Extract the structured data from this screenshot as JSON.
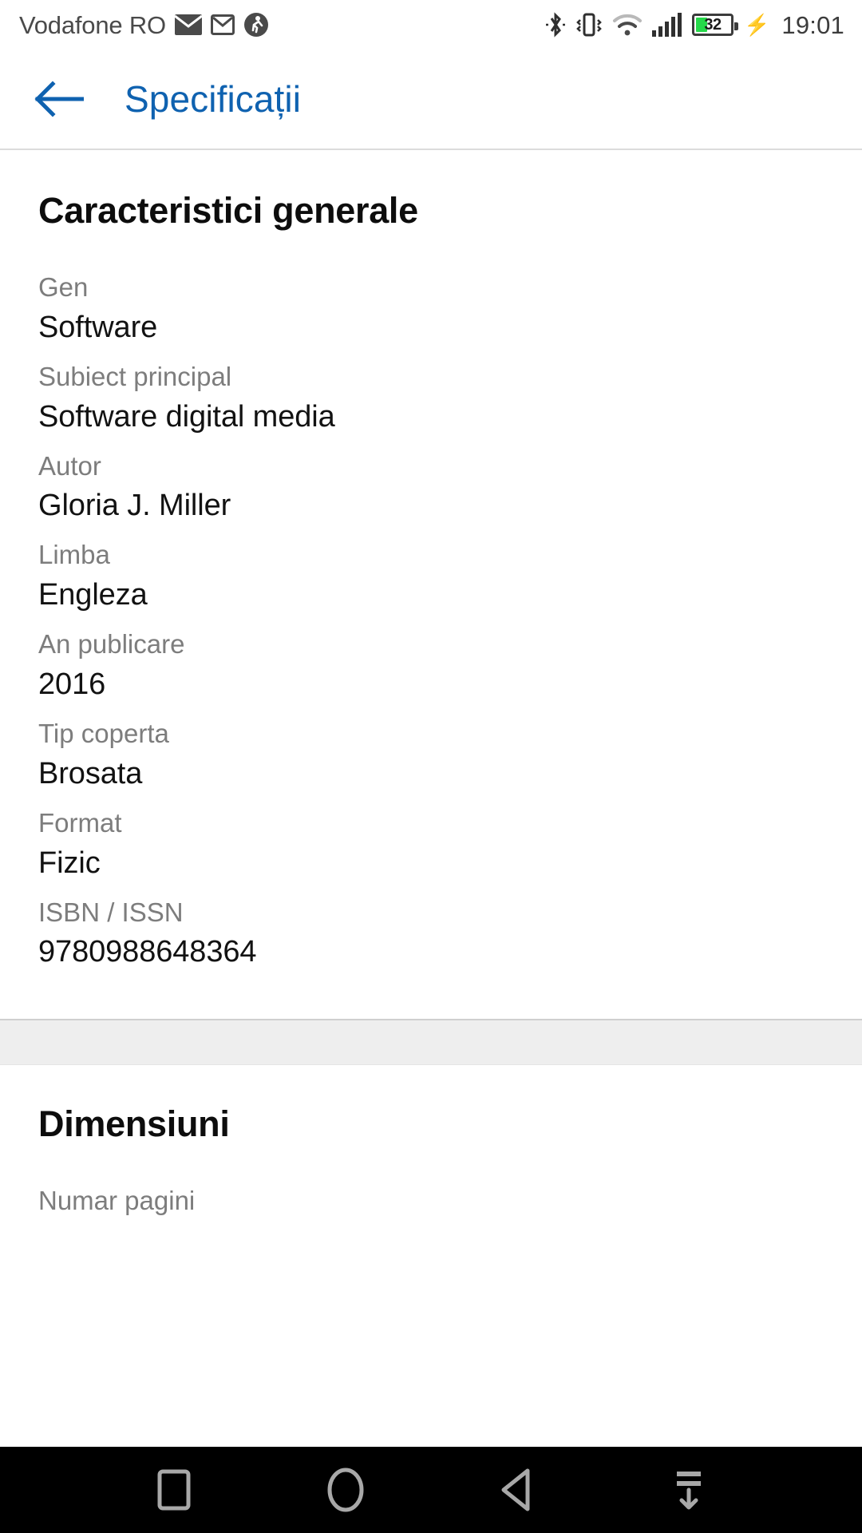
{
  "status_bar": {
    "carrier": "Vodafone RO",
    "clock": "19:01",
    "battery_percent": "32",
    "icons": [
      "mail-icon",
      "gmail-icon",
      "activity-icon",
      "bluetooth-icon",
      "vibrate-icon",
      "wifi-icon",
      "signal-icon",
      "battery-icon",
      "charging-bolt-icon"
    ]
  },
  "app_bar": {
    "back_label": "back-arrow",
    "title": "Specificații",
    "accent_color": "#0f62b0"
  },
  "sections": [
    {
      "title": "Caracteristici generale",
      "rows": [
        {
          "label": "Gen",
          "value": "Software"
        },
        {
          "label": "Subiect principal",
          "value": "Software digital media"
        },
        {
          "label": "Autor",
          "value": "Gloria J. Miller"
        },
        {
          "label": "Limba",
          "value": "Engleza"
        },
        {
          "label": "An publicare",
          "value": "2016"
        },
        {
          "label": "Tip coperta",
          "value": "Brosata"
        },
        {
          "label": "Format",
          "value": "Fizic"
        },
        {
          "label": "ISBN / ISSN",
          "value": "9780988648364"
        }
      ]
    },
    {
      "title": "Dimensiuni",
      "rows": [
        {
          "label": "Numar pagini",
          "value": ""
        }
      ]
    }
  ],
  "nav_bar": {
    "buttons": [
      "recents-button",
      "home-button",
      "back-button",
      "hide-navbar-button"
    ]
  }
}
